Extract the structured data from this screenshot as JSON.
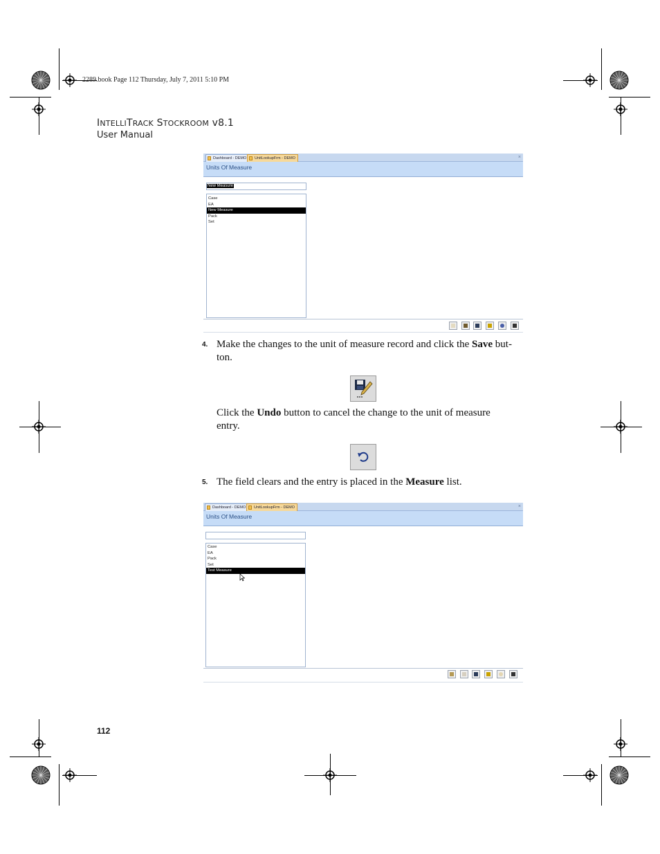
{
  "slug": "2289.book  Page 112  Thursday, July 7, 2011  5:10 PM",
  "header": {
    "title_cap1": "I",
    "title_small1": "NTELLI",
    "title_cap2": "T",
    "title_small2": "RACK",
    "title_cap3": "S",
    "title_small3": "TOCKROOM",
    "title_version": " v8.1",
    "subtitle": "User Manual"
  },
  "screenshot1": {
    "tabs": [
      "Dashboard - DEMO",
      "UnitLookupFrm - DEMO"
    ],
    "close": "×",
    "form_title": "Units Of Measure",
    "field_value": "New Measure",
    "list_items": [
      "Case",
      "EA",
      "New Measure",
      "Pack",
      "Set"
    ],
    "selected_index": 2
  },
  "step4": {
    "number": "4.",
    "text_a": "Make the changes to the unit of measure record and click the ",
    "bold_a": "Save",
    "text_b": " but-",
    "line2": "ton."
  },
  "undo_para": {
    "text_a": "Click the ",
    "bold_a": "Undo",
    "text_b": " button to cancel the change to the unit of measure",
    "line2": "entry."
  },
  "step5": {
    "number": "5.",
    "text_a": "The field clears and the entry is placed in the ",
    "bold_a": "Measure",
    "text_b": " list."
  },
  "screenshot2": {
    "tabs": [
      "Dashboard - DEMO",
      "UnitLookupFrm - DEMO"
    ],
    "close": "×",
    "form_title": "Units Of Measure",
    "field_value": "",
    "list_items": [
      "Case",
      "EA",
      "Pack",
      "Set",
      "Test Measure"
    ],
    "selected_index": 4
  },
  "page_number": "112",
  "colors": {
    "tab_bar": "#c7d8ef",
    "form_header": "#c6dcf7",
    "active_tab": "#f7d99a",
    "title_text": "#2b4f85"
  }
}
